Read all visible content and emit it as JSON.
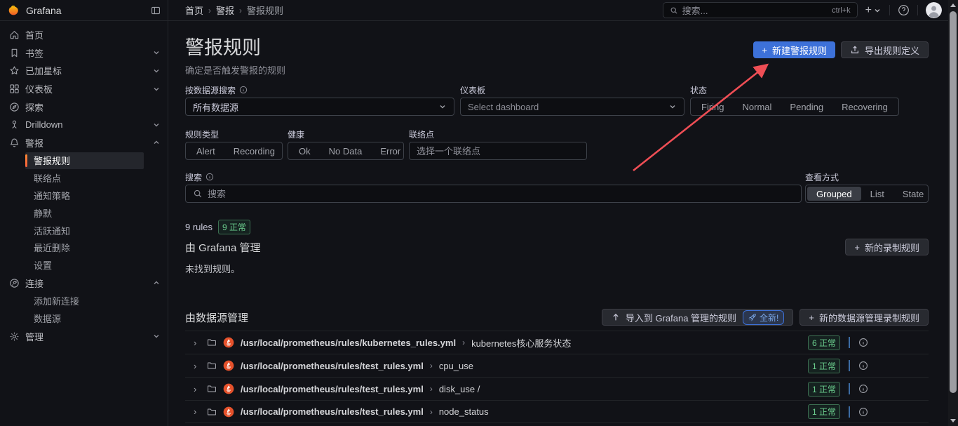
{
  "colors": {
    "accent_blue": "#3d71d9",
    "ok_green": "#6ccf8e",
    "prometheus_orange": "#e6522c",
    "active_item_bar": "#ff8833",
    "annotation_arrow_red": "#ef4e55"
  },
  "topnav": {
    "brand": "Grafana",
    "breadcrumb": [
      "首页",
      "警报",
      "警报规则"
    ],
    "search_placeholder": "搜索...",
    "search_shortcut": "ctrl+k"
  },
  "sidebar": {
    "items": [
      {
        "name": "home",
        "label": "首页",
        "icon": "home-icon"
      },
      {
        "name": "bookmarks",
        "label": "书签",
        "icon": "bookmark-icon",
        "chevron": "down"
      },
      {
        "name": "starred",
        "label": "已加星标",
        "icon": "star-icon",
        "chevron": "down"
      },
      {
        "name": "dashboards",
        "label": "仪表板",
        "icon": "dashboards-icon",
        "chevron": "down"
      },
      {
        "name": "explore",
        "label": "探索",
        "icon": "compass-icon"
      },
      {
        "name": "drilldown",
        "label": "Drilldown",
        "icon": "drilldown-icon",
        "chevron": "down"
      },
      {
        "name": "alerting",
        "label": "警报",
        "icon": "bell-icon",
        "chevron": "up",
        "children": [
          {
            "name": "alert-rules",
            "label": "警报规则",
            "active": true
          },
          {
            "name": "contact-points",
            "label": "联络点"
          },
          {
            "name": "notification-policies",
            "label": "通知策略"
          },
          {
            "name": "silences",
            "label": "静默"
          },
          {
            "name": "active-notifications",
            "label": "活跃通知"
          },
          {
            "name": "recently-deleted",
            "label": "最近删除"
          },
          {
            "name": "settings",
            "label": "设置"
          }
        ]
      },
      {
        "name": "connections",
        "label": "连接",
        "icon": "plug-icon",
        "chevron": "up",
        "children": [
          {
            "name": "add-new-connection",
            "label": "添加新连接"
          },
          {
            "name": "data-sources",
            "label": "数据源"
          }
        ]
      },
      {
        "name": "administration",
        "label": "管理",
        "icon": "gear-icon",
        "chevron": "down"
      }
    ]
  },
  "page": {
    "title": "警报规则",
    "subtitle": "确定是否触发警报的规则",
    "new_alert_rule_button": "新建警报规则",
    "export_rules_button": "导出规则定义"
  },
  "filters": {
    "datasource_label": "按数据源搜索",
    "datasource_value": "所有数据源",
    "dashboard_label": "仪表板",
    "dashboard_placeholder": "Select dashboard",
    "state_label": "状态",
    "state_options": [
      "Firing",
      "Normal",
      "Pending",
      "Recovering"
    ],
    "rule_type_label": "规则类型",
    "rule_type_options": [
      "Alert",
      "Recording"
    ],
    "health_label": "健康",
    "health_options": [
      "Ok",
      "No Data",
      "Error"
    ],
    "contact_label": "联络点",
    "contact_placeholder": "选择一个联络点",
    "search_label": "搜索",
    "search_placeholder": "搜索",
    "view_label": "查看方式",
    "view_options": [
      "Grouped",
      "List",
      "State"
    ],
    "view_selected": "Grouped"
  },
  "summary": {
    "count_text": "9 rules",
    "ok_badge": "9 正常"
  },
  "grafana_managed": {
    "title": "由 Grafana 管理",
    "new_recording_rule_button": "新的录制规则",
    "empty_text": "未找到规则。"
  },
  "datasource_managed": {
    "title": "由数据源管理",
    "import_button": "导入到 Grafana 管理的规则",
    "new_badge": "全新!",
    "new_recording_rule_button": "新的数据源管理录制规则",
    "rows": [
      {
        "path": "/usr/local/prometheus/rules/kubernetes_rules.yml",
        "group": "kubernetes核心服务状态",
        "badge": "6 正常"
      },
      {
        "path": "/usr/local/prometheus/rules/test_rules.yml",
        "group": "cpu_use",
        "badge": "1 正常"
      },
      {
        "path": "/usr/local/prometheus/rules/test_rules.yml",
        "group": "disk_use /",
        "badge": "1 正常"
      },
      {
        "path": "/usr/local/prometheus/rules/test_rules.yml",
        "group": "node_status",
        "badge": "1 正常"
      }
    ]
  }
}
